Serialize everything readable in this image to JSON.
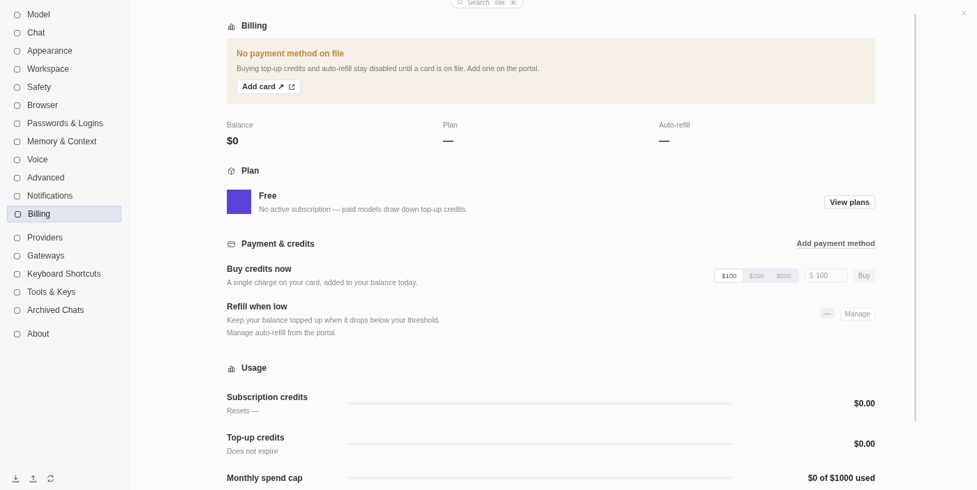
{
  "search": {
    "placeholder": "Search",
    "keys": [
      "Ctrl",
      "K"
    ]
  },
  "sidebar": {
    "groups": [
      [
        {
          "label": "Model",
          "selected": false
        },
        {
          "label": "Chat",
          "selected": false
        },
        {
          "label": "Appearance",
          "selected": false
        },
        {
          "label": "Workspace",
          "selected": false
        },
        {
          "label": "Safety",
          "selected": false
        },
        {
          "label": "Browser",
          "selected": false
        },
        {
          "label": "Passwords & Logins",
          "selected": false
        },
        {
          "label": "Memory & Context",
          "selected": false
        },
        {
          "label": "Voice",
          "selected": false
        },
        {
          "label": "Advanced",
          "selected": false
        },
        {
          "label": "Notifications",
          "selected": false
        },
        {
          "label": "Billing",
          "selected": true
        }
      ],
      [
        {
          "label": "Providers",
          "selected": false
        },
        {
          "label": "Gateways",
          "selected": false
        },
        {
          "label": "Keyboard Shortcuts",
          "selected": false
        },
        {
          "label": "Tools & Keys",
          "selected": false
        },
        {
          "label": "Archived Chats",
          "selected": false
        }
      ],
      [
        {
          "label": "About",
          "selected": false
        }
      ]
    ]
  },
  "page": {
    "title": "Billing"
  },
  "alert": {
    "title": "No payment method on file",
    "text": "Buying top-up credits and auto-refill stay disabled until a card is on file. Add one on the portal.",
    "button": "Add card ↗"
  },
  "stats": [
    {
      "label": "Balance",
      "value": "$0"
    },
    {
      "label": "Plan",
      "value": "—"
    },
    {
      "label": "Auto-refill",
      "value": "—"
    }
  ],
  "plan": {
    "heading": "Plan",
    "name": "Free",
    "description": "No active subscription — paid models draw down top-up credits.",
    "button": "View plans"
  },
  "payment": {
    "heading": "Payment & credits",
    "link": "Add payment method",
    "buy": {
      "title": "Buy credits now",
      "description": "A single charge on your card, added to your balance today.",
      "amounts": [
        {
          "label": "$100",
          "selected": true
        },
        {
          "label": "$250",
          "selected": false
        },
        {
          "label": "$500",
          "selected": false
        }
      ],
      "currency": "$",
      "placeholder": "100",
      "button": "Buy"
    },
    "refill": {
      "title": "Refill when low",
      "lines": [
        "Keep your balance topped up when it drops below your threshold.",
        "Manage auto-refill from the portal."
      ],
      "status": "—",
      "button": "Manage"
    }
  },
  "usage": {
    "heading": "Usage",
    "rows": [
      {
        "title": "Subscription credits",
        "note": "Resets —",
        "level": 0,
        "amount": "$0.00"
      },
      {
        "title": "Top-up credits",
        "note": "Does not expire",
        "level": 0,
        "amount": "$0.00"
      },
      {
        "title": "Monthly spend cap",
        "level": 0,
        "amount": "$0 of $1000 used"
      }
    ]
  }
}
